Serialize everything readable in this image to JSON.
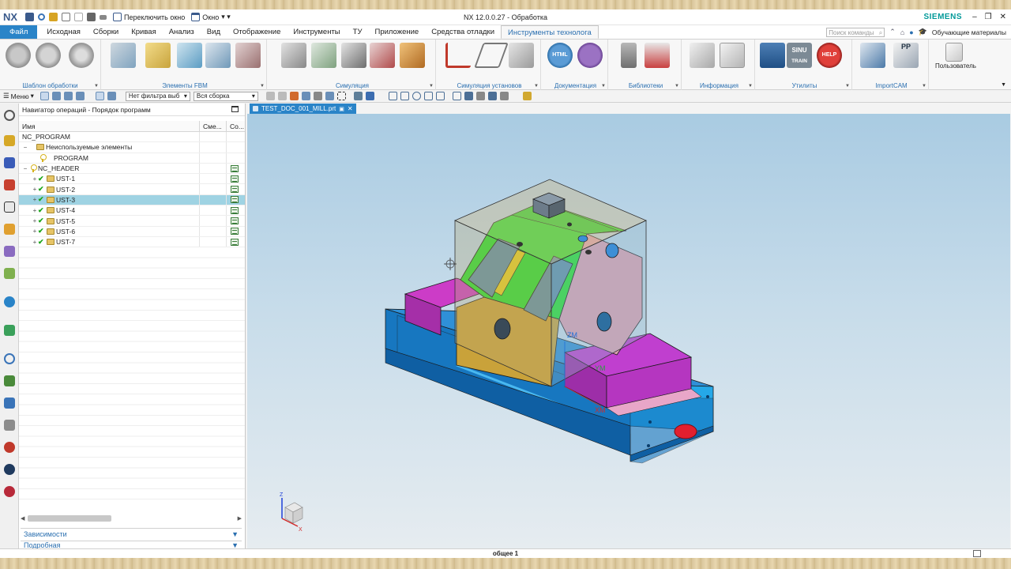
{
  "window": {
    "logo": "NX",
    "title": "NX 12.0.0.27 - Обработка",
    "brand": "SIEMENS",
    "switch_window": "Переключить окно",
    "window_menu": "Окно"
  },
  "menu": {
    "file": "Файл",
    "tabs": [
      "Исходная",
      "Сборки",
      "Кривая",
      "Анализ",
      "Вид",
      "Отображение",
      "Инструменты",
      "ТУ",
      "Приложение",
      "Средства отладки",
      "Инструменты технолога"
    ],
    "active_tab": "Инструменты технолога",
    "search_placeholder": "Поиск команды",
    "training": "Обучающие материалы"
  },
  "ribbon": {
    "groups": [
      {
        "label": "Шаблон обработки"
      },
      {
        "label": "Элементы FBM"
      },
      {
        "label": "Симуляция"
      },
      {
        "label": "Симуляция установов"
      },
      {
        "label": "Документация"
      },
      {
        "label": "Библиотеки"
      },
      {
        "label": "Информация"
      },
      {
        "label": "Утилиты"
      },
      {
        "label": "ImportCAM"
      }
    ],
    "user_button": "Пользователь",
    "icon_texts": {
      "html": "HTML",
      "sinu": "SINU",
      "train": "TRAIN",
      "help": "HELP",
      "pp": "PP"
    }
  },
  "selection_bar": {
    "menu": "Меню",
    "filter": "Нет фильтра выб",
    "scope": "Вся сборка"
  },
  "navigator": {
    "title": "Навигатор операций - Порядок программ",
    "columns": [
      "Имя",
      "Сме...",
      "Со..."
    ],
    "rows": [
      {
        "name": "NC_PROGRAM",
        "level": 0
      },
      {
        "name": "Неиспользуемые элементы",
        "level": 1
      },
      {
        "name": "PROGRAM",
        "level": 2
      },
      {
        "name": "NC_HEADER",
        "level": 1
      },
      {
        "name": "UST-1",
        "level": 2
      },
      {
        "name": "UST-2",
        "level": 2
      },
      {
        "name": "UST-3",
        "level": 2,
        "selected": true
      },
      {
        "name": "UST-4",
        "level": 2
      },
      {
        "name": "UST-5",
        "level": 2
      },
      {
        "name": "UST-6",
        "level": 2
      },
      {
        "name": "UST-7",
        "level": 2
      }
    ],
    "panels": [
      "Зависимости",
      "Подробная"
    ]
  },
  "graphics": {
    "tab": "TEST_DOC_001_MILL.prt",
    "labels": {
      "zm": "ZM",
      "ym": "YM",
      "xm": "XM",
      "triad_z": "Z",
      "triad_x": "X"
    }
  },
  "status": {
    "text": "общее 1"
  },
  "colors": {
    "accent": "#2a84c8",
    "selected_row": "#9fd3e3",
    "brand": "#009999"
  }
}
